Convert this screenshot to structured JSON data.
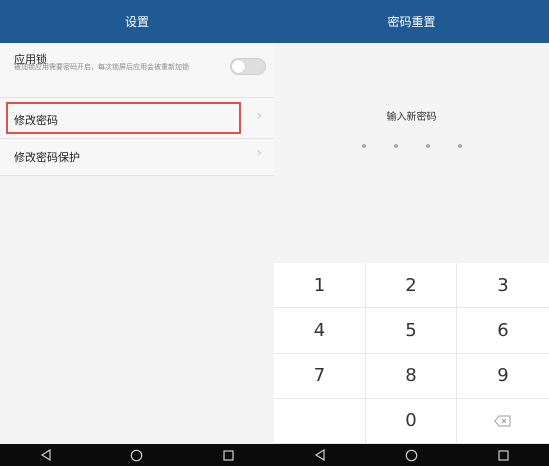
{
  "settings": {
    "title": "设置",
    "app_lock": {
      "title": "应用锁",
      "description": "被加锁应用需要密码开启，每次锁屏后应用会被重新加锁",
      "enabled": false
    },
    "change_password": {
      "label": "修改密码"
    },
    "change_password_protection": {
      "label": "修改密码保护"
    }
  },
  "reset": {
    "title": "密码重置",
    "prompt": "输入新密码",
    "digits_total": 4,
    "keys": [
      "1",
      "2",
      "3",
      "4",
      "5",
      "6",
      "7",
      "8",
      "9",
      "",
      "0",
      "backspace-icon"
    ]
  },
  "navbar": [
    "back-icon",
    "home-icon",
    "recents-icon"
  ]
}
